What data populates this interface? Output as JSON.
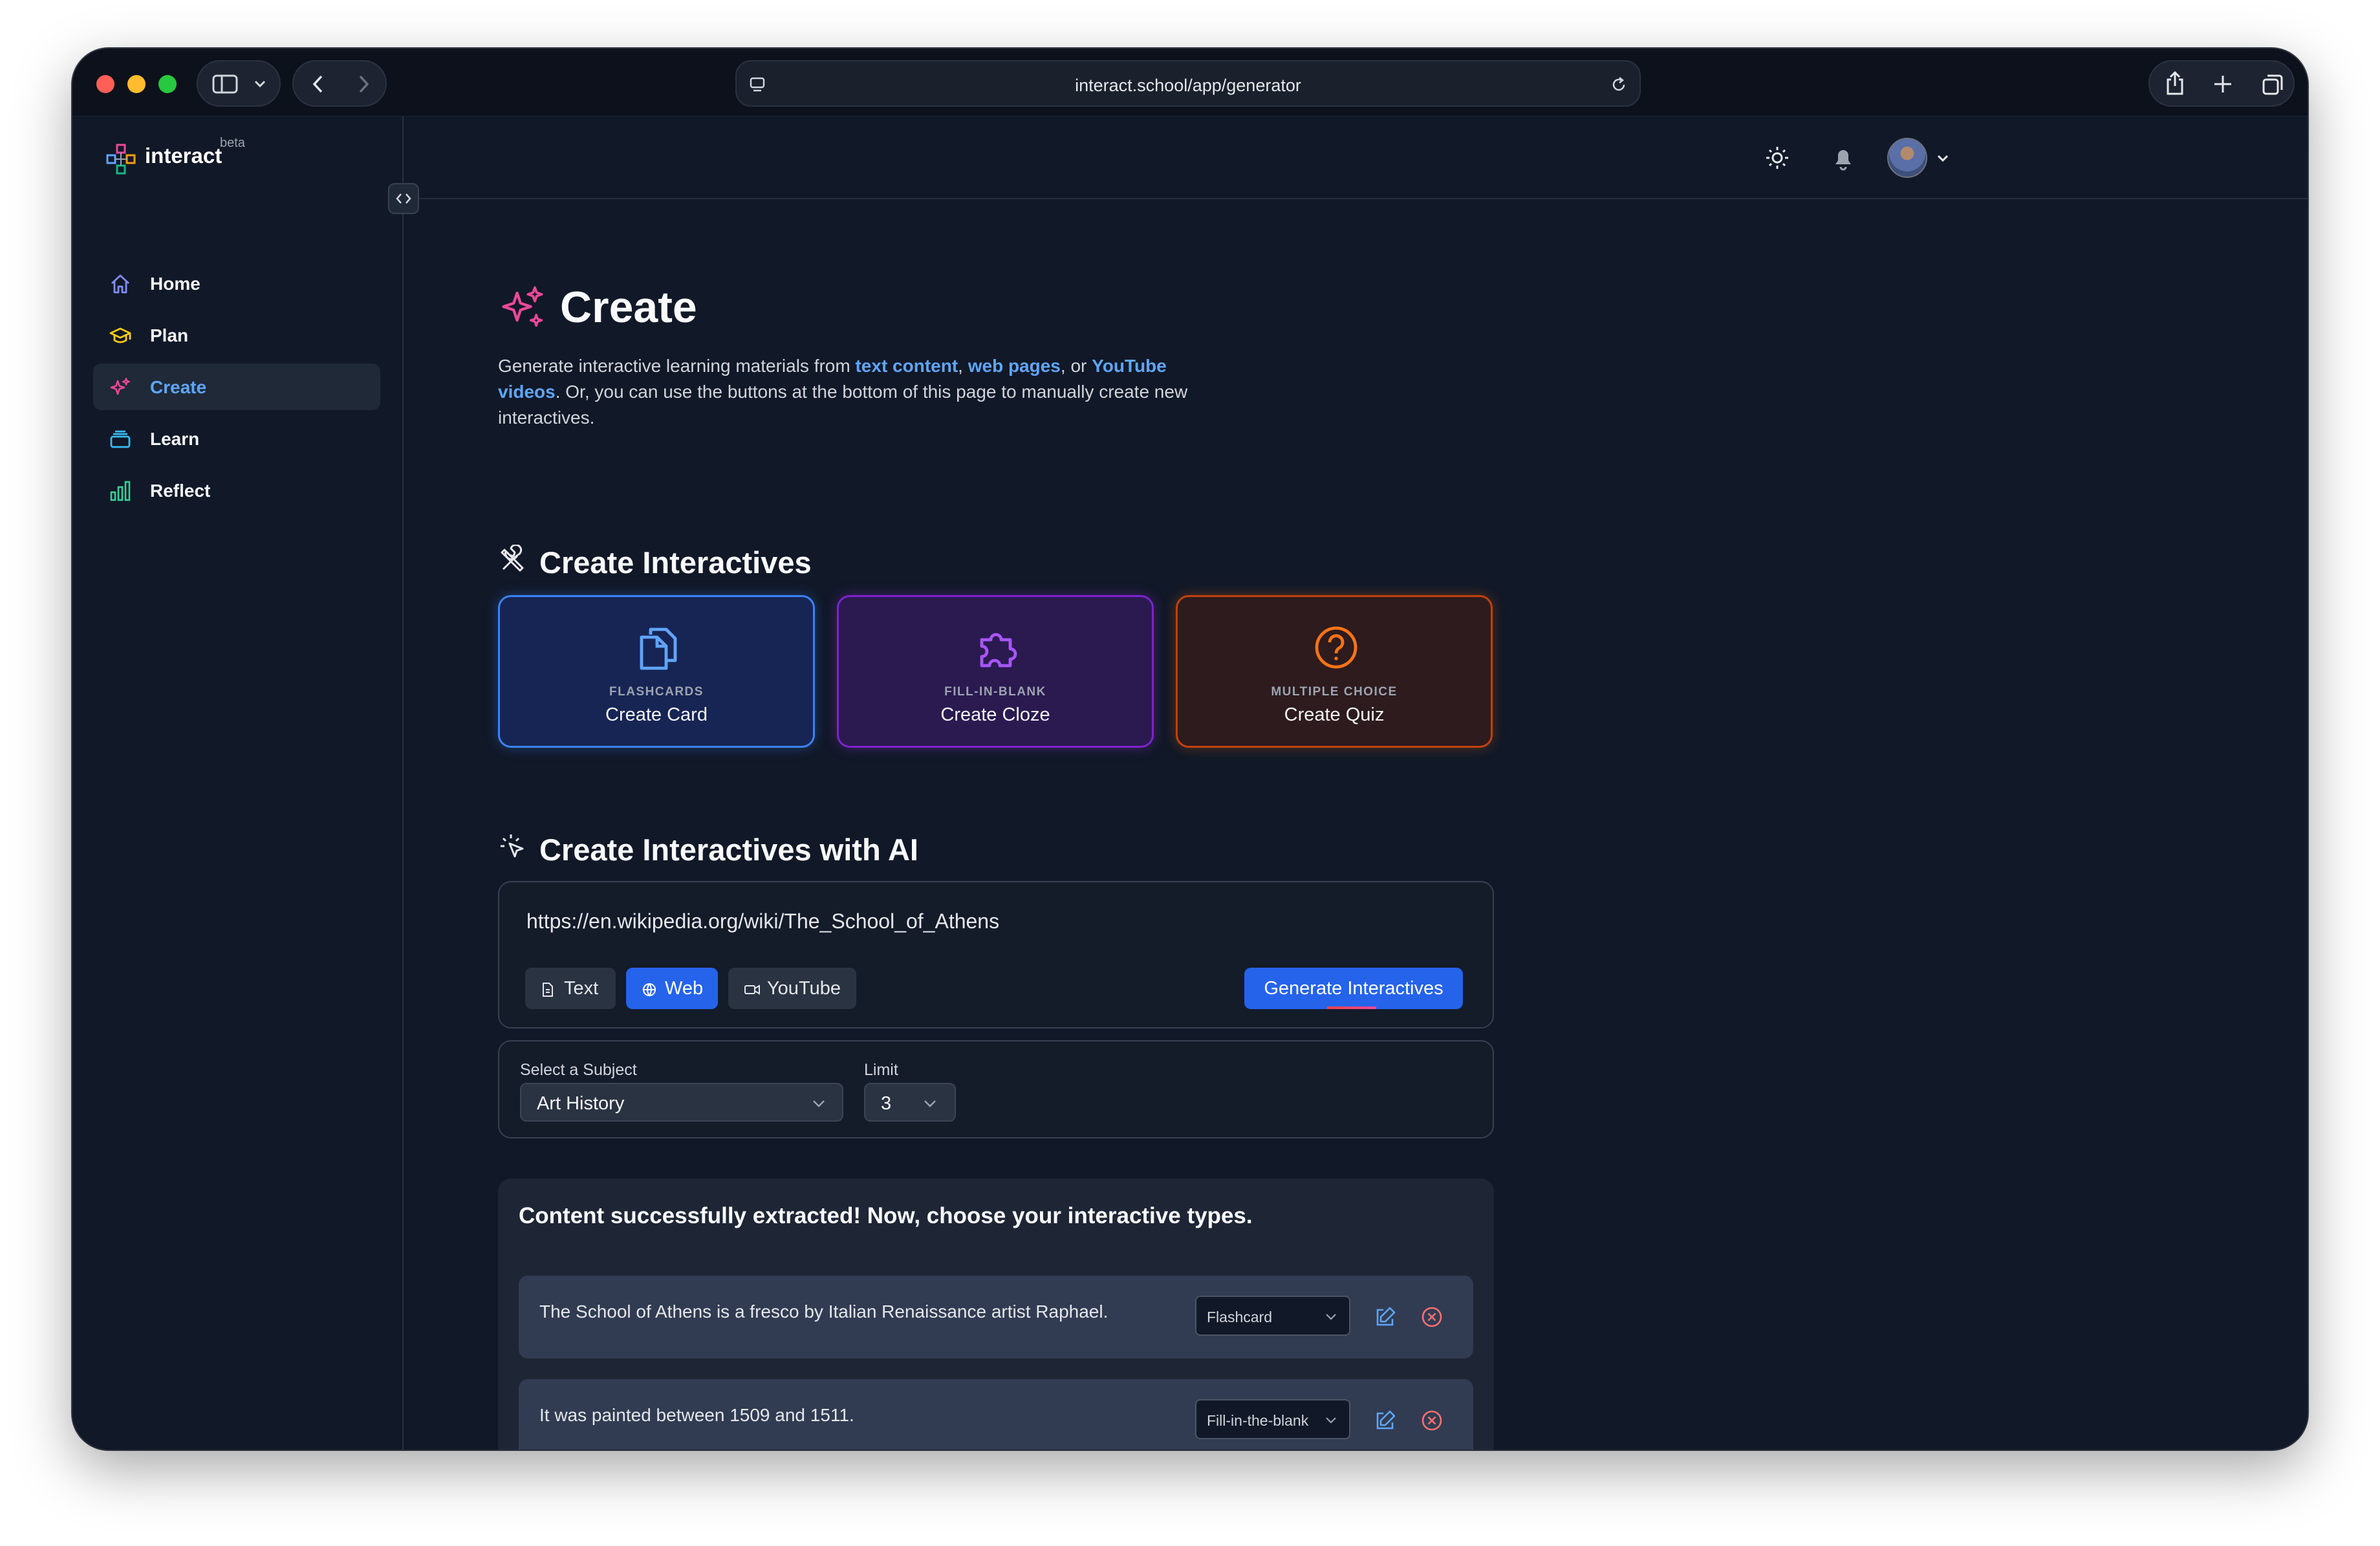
{
  "browser": {
    "url": "interact.school/app/generator"
  },
  "sidebar": {
    "logo": "interact",
    "beta": "beta",
    "items": [
      {
        "label": "Home",
        "icon": "home-icon"
      },
      {
        "label": "Plan",
        "icon": "graduation-cap-icon"
      },
      {
        "label": "Create",
        "icon": "sparkles-icon",
        "active": true
      },
      {
        "label": "Learn",
        "icon": "stack-icon"
      },
      {
        "label": "Reflect",
        "icon": "bar-chart-icon"
      }
    ]
  },
  "page": {
    "title": "Create",
    "intro": {
      "t1": "Generate interactive learning materials from ",
      "l1": "text content",
      "t2": ", ",
      "l2": "web pages",
      "t3": ", or ",
      "l3": "YouTube videos",
      "t4": ". Or, you can use the buttons at the bottom of this page to manually create new interactives."
    }
  },
  "create_section": {
    "title": "Create Interactives",
    "cards": [
      {
        "kicker": "FLASHCARDS",
        "title": "Create Card",
        "icon": "documents-icon",
        "color": "#3b82f6"
      },
      {
        "kicker": "FILL-IN-BLANK",
        "title": "Create Cloze",
        "icon": "puzzle-icon",
        "color": "#9333ea"
      },
      {
        "kicker": "MULTIPLE CHOICE",
        "title": "Create Quiz",
        "icon": "question-circle-icon",
        "color": "#f97316"
      }
    ]
  },
  "ai_section": {
    "title": "Create Interactives with AI",
    "input_value": "https://en.wikipedia.org/wiki/The_School_of_Athens",
    "sources": [
      {
        "label": "Text",
        "active": false
      },
      {
        "label": "Web",
        "active": true
      },
      {
        "label": "YouTube",
        "active": false
      }
    ],
    "generate_label": "Generate Interactives",
    "subject_label": "Select a Subject",
    "subject_value": "Art History",
    "limit_label": "Limit",
    "limit_value": "3"
  },
  "results": {
    "heading": "Content successfully extracted! Now, choose your interactive types.",
    "rows": [
      {
        "text": "The School of Athens is a fresco by Italian Renaissance artist Raphael.",
        "type": "Flashcard"
      },
      {
        "text": "It was painted between 1509 and 1511.",
        "type": "Fill-in-the-blank"
      }
    ]
  },
  "colors": {
    "accent": "#2563eb",
    "link": "#60a5fa",
    "background": "#111827",
    "title_icon": "#ec4899"
  }
}
